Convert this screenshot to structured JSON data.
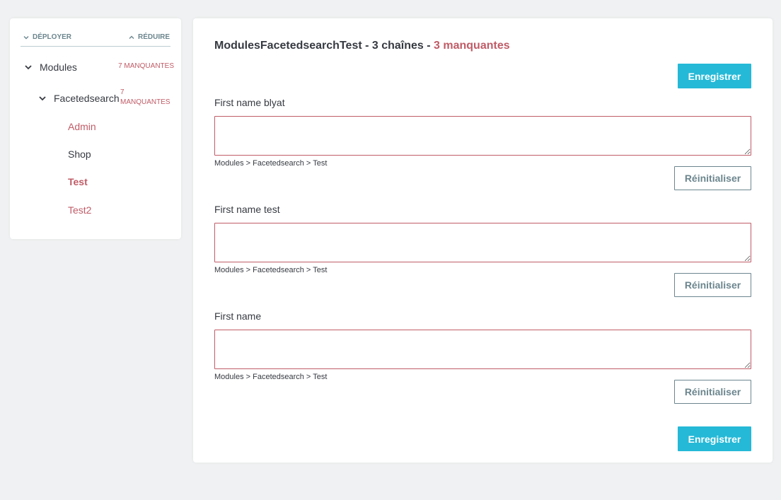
{
  "sidebar": {
    "expand_label": "DÉPLOYER",
    "reduce_label": "RÉDUIRE",
    "modules": {
      "label": "Modules",
      "missing": "7 MANQUANTES"
    },
    "facetedsearch": {
      "label": "Facetedsearch",
      "missing_count": "7",
      "missing_word": "MANQUANTES"
    },
    "leaves": [
      {
        "label": "Admin",
        "state": "missing"
      },
      {
        "label": "Shop",
        "state": "ok"
      },
      {
        "label": "Test",
        "state": "active"
      },
      {
        "label": "Test2",
        "state": "missing"
      }
    ]
  },
  "main": {
    "title_prefix": "ModulesFacetedsearchTest - 3 chaînes - ",
    "title_missing": "3 manquantes",
    "save_label": "Enregistrer",
    "reset_label": "Réinitialiser",
    "fields": [
      {
        "label": "First name blyat",
        "value": "",
        "breadcrumb": "Modules > Facetedsearch > Test"
      },
      {
        "label": "First name test",
        "value": "",
        "breadcrumb": "Modules > Facetedsearch > Test"
      },
      {
        "label": "First name",
        "value": "",
        "breadcrumb": "Modules > Facetedsearch > Test"
      }
    ]
  },
  "colors": {
    "accent": "#25b9d7",
    "missing": "#c05c67",
    "text": "#363a41",
    "muted": "#6c868e",
    "background": "#eff1f2"
  },
  "icons": {
    "expand": "chevron-down-icon",
    "reduce": "chevron-up-icon",
    "node_toggle": "chevron-down-icon"
  }
}
